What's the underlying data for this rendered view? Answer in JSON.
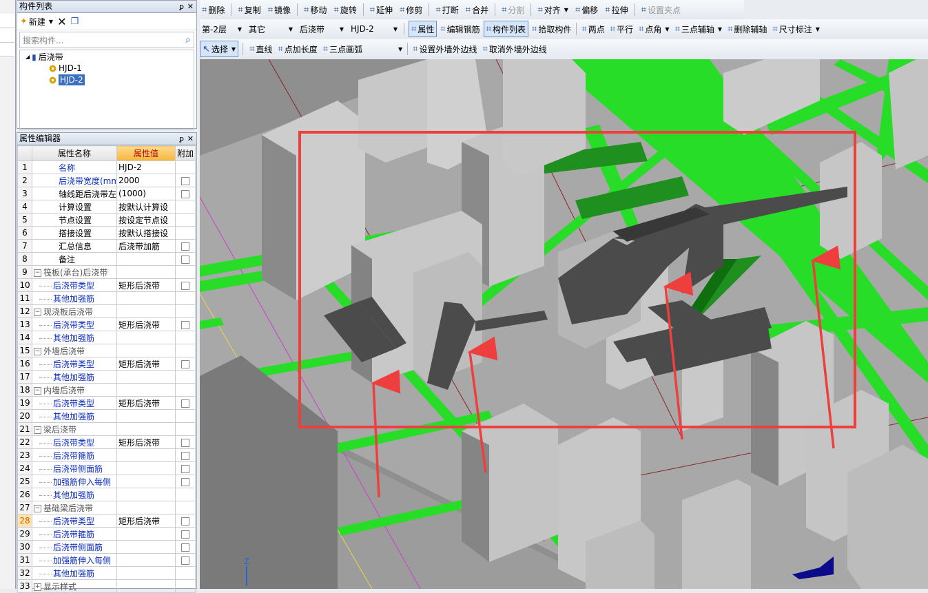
{
  "left_panel": {
    "component_list": {
      "title": "构件列表",
      "new_label": "新建",
      "search_placeholder": "搜索构件...",
      "tree": {
        "root": "后浇带",
        "items": [
          "HJD-1",
          "HJD-2"
        ],
        "selected": "HJD-2"
      }
    },
    "property_editor": {
      "title": "属性编辑器",
      "headers": {
        "name": "属性名称",
        "value": "属性值",
        "extra": "附加"
      },
      "rows": [
        {
          "no": "1",
          "name": "名称",
          "value": "HJD-2",
          "style": "blue"
        },
        {
          "no": "2",
          "name": "后浇带宽度(mm)",
          "value": "2000",
          "style": "blue",
          "check": true
        },
        {
          "no": "3",
          "name": "轴线距后浇带左边",
          "value": "(1000)",
          "style": "black",
          "check": true
        },
        {
          "no": "4",
          "name": "计算设置",
          "value": "按默认计算设",
          "style": "black"
        },
        {
          "no": "5",
          "name": "节点设置",
          "value": "按设定节点设",
          "style": "black"
        },
        {
          "no": "6",
          "name": "搭接设置",
          "value": "按默认搭接设",
          "style": "black"
        },
        {
          "no": "7",
          "name": "汇总信息",
          "value": "后浇带加筋",
          "style": "black",
          "check": true
        },
        {
          "no": "8",
          "name": "备注",
          "value": "",
          "style": "black",
          "check": true
        },
        {
          "no": "9",
          "name": "筏板(承台)后浇带",
          "value": "",
          "style": "group"
        },
        {
          "no": "10",
          "name": "后浇带类型",
          "value": "矩形后浇带",
          "style": "child",
          "check": true
        },
        {
          "no": "11",
          "name": "其他加强筋",
          "value": "",
          "style": "child"
        },
        {
          "no": "12",
          "name": "现浇板后浇带",
          "value": "",
          "style": "group"
        },
        {
          "no": "13",
          "name": "后浇带类型",
          "value": "矩形后浇带",
          "style": "child",
          "check": true
        },
        {
          "no": "14",
          "name": "其他加强筋",
          "value": "",
          "style": "child"
        },
        {
          "no": "15",
          "name": "外墙后浇带",
          "value": "",
          "style": "group"
        },
        {
          "no": "16",
          "name": "后浇带类型",
          "value": "矩形后浇带",
          "style": "child",
          "check": true
        },
        {
          "no": "17",
          "name": "其他加强筋",
          "value": "",
          "style": "child"
        },
        {
          "no": "18",
          "name": "内墙后浇带",
          "value": "",
          "style": "group"
        },
        {
          "no": "19",
          "name": "后浇带类型",
          "value": "矩形后浇带",
          "style": "child",
          "check": true
        },
        {
          "no": "20",
          "name": "其他加强筋",
          "value": "",
          "style": "child"
        },
        {
          "no": "21",
          "name": "梁后浇带",
          "value": "",
          "style": "group"
        },
        {
          "no": "22",
          "name": "后浇带类型",
          "value": "矩形后浇带",
          "style": "child",
          "check": true
        },
        {
          "no": "23",
          "name": "后浇带箍筋",
          "value": "",
          "style": "child",
          "check": true
        },
        {
          "no": "24",
          "name": "后浇带侧面筋",
          "value": "",
          "style": "child",
          "check": true
        },
        {
          "no": "25",
          "name": "加强筋伸入每侧",
          "value": "",
          "style": "child",
          "check": true
        },
        {
          "no": "26",
          "name": "其他加强筋",
          "value": "",
          "style": "child"
        },
        {
          "no": "27",
          "name": "基础梁后浇带",
          "value": "",
          "style": "group"
        },
        {
          "no": "28",
          "name": "后浇带类型",
          "value": "矩形后浇带",
          "style": "child",
          "check": true,
          "current": true
        },
        {
          "no": "29",
          "name": "后浇带箍筋",
          "value": "",
          "style": "child",
          "check": true
        },
        {
          "no": "30",
          "name": "后浇带侧面筋",
          "value": "",
          "style": "child",
          "check": true
        },
        {
          "no": "31",
          "name": "加强筋伸入每侧",
          "value": "",
          "style": "child",
          "check": true
        },
        {
          "no": "32",
          "name": "其他加强筋",
          "value": "",
          "style": "child"
        },
        {
          "no": "33",
          "name": "显示样式",
          "value": "",
          "style": "groupplus"
        }
      ]
    }
  },
  "toolbar1": [
    {
      "icon": "eraser-icon",
      "label": "删除"
    },
    {
      "icon": "copy-icon",
      "label": "复制"
    },
    {
      "icon": "mirror-icon",
      "label": "镜像"
    },
    {
      "icon": "move-icon",
      "label": "移动"
    },
    {
      "icon": "rotate-icon",
      "label": "旋转"
    },
    {
      "icon": "extend-icon",
      "label": "延伸"
    },
    {
      "icon": "trim-icon",
      "label": "修剪"
    },
    {
      "icon": "break-icon",
      "label": "打断"
    },
    {
      "icon": "merge-icon",
      "label": "合并"
    },
    {
      "icon": "split-icon",
      "label": "分割",
      "disabled": true
    },
    {
      "icon": "align-icon",
      "label": "对齐",
      "dropdown": true
    },
    {
      "icon": "offset-icon",
      "label": "偏移"
    },
    {
      "icon": "stretch-icon",
      "label": "拉伸"
    },
    {
      "icon": "grip-icon",
      "label": "设置夹点",
      "disabled": true
    }
  ],
  "toolbar2": {
    "floor": "第-2层",
    "category": "其它",
    "type": "后浇带",
    "component": "HJD-2",
    "buttons": [
      {
        "icon": "properties-icon",
        "label": "属性",
        "pressed": true
      },
      {
        "icon": "edit-rebar-icon",
        "label": "编辑钢筋"
      },
      {
        "icon": "component-list-icon",
        "label": "构件列表",
        "pressed": true
      },
      {
        "icon": "pick-icon",
        "label": "拾取构件"
      },
      {
        "icon": "two-point-icon",
        "label": "两点"
      },
      {
        "icon": "parallel-icon",
        "label": "平行"
      },
      {
        "icon": "point-angle-icon",
        "label": "点角",
        "dropdown": true
      },
      {
        "icon": "three-point-axis-icon",
        "label": "三点辅轴",
        "dropdown": true
      },
      {
        "icon": "delete-axis-icon",
        "label": "删除辅轴"
      },
      {
        "icon": "dimension-icon",
        "label": "尺寸标注",
        "dropdown": true
      }
    ]
  },
  "toolbar3": {
    "select_label": "选择",
    "buttons": [
      {
        "icon": "line-icon",
        "label": "直线"
      },
      {
        "icon": "point-length-icon",
        "label": "点加长度"
      },
      {
        "icon": "arc-icon",
        "label": "三点画弧"
      },
      {
        "icon": "set-outer-wall-icon",
        "label": "设置外墙外边线"
      },
      {
        "icon": "cancel-outer-wall-icon",
        "label": "取消外墙外边线"
      }
    ]
  },
  "viewport": {
    "axis_label": "Z",
    "highlight_color": "#ef3e3e",
    "green_color": "#27dd27"
  }
}
